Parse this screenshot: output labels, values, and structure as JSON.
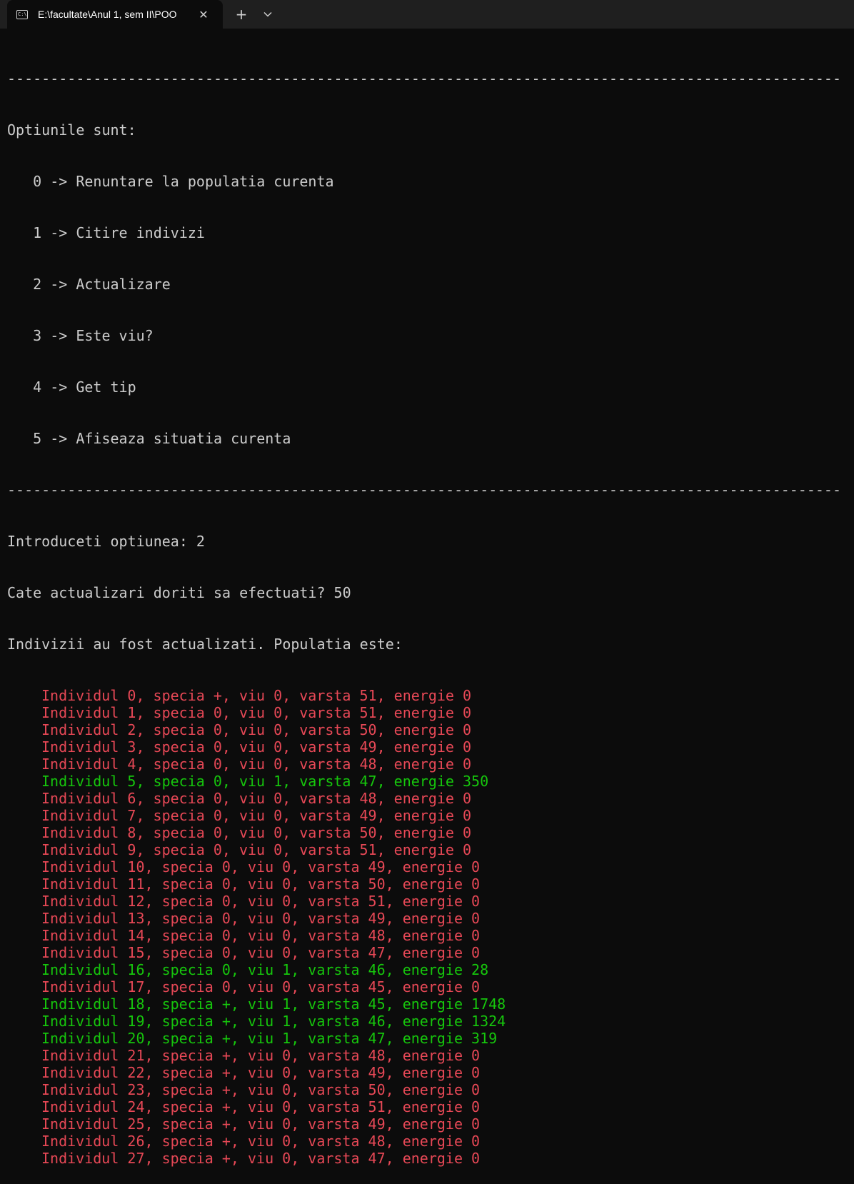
{
  "tab": {
    "title": "E:\\facultate\\Anul 1, sem II\\POO",
    "close_glyph": "✕",
    "icon": "terminal-icon"
  },
  "toolbar": {
    "new_tab_glyph": "+",
    "dropdown_icon": "chevron-down-icon"
  },
  "colors": {
    "background": "#0c0c0c",
    "text": "#cccccc",
    "dead": "#e74856",
    "alive": "#16c60c"
  },
  "console": {
    "separator": "-------------------------------------------------------------------------------------------------",
    "menu_header": "Optiunile sunt:",
    "options": [
      "   0 -> Renuntare la populatia curenta",
      "   1 -> Citire indivizi",
      "   2 -> Actualizare",
      "   3 -> Este viu?",
      "   4 -> Get tip",
      "   5 -> Afiseaza situatia curenta"
    ],
    "prompt": "Introduceti optiunea: 2",
    "question": "Cate actualizari doriti sa efectuati? 50",
    "result": "Indivizii au fost actualizati. Populatia este:",
    "individuals": [
      {
        "text": "Individul 0, specia +, viu 0, varsta 51, energie 0",
        "alive": false
      },
      {
        "text": "Individul 1, specia 0, viu 0, varsta 51, energie 0",
        "alive": false
      },
      {
        "text": "Individul 2, specia 0, viu 0, varsta 50, energie 0",
        "alive": false
      },
      {
        "text": "Individul 3, specia 0, viu 0, varsta 49, energie 0",
        "alive": false
      },
      {
        "text": "Individul 4, specia 0, viu 0, varsta 48, energie 0",
        "alive": false
      },
      {
        "text": "Individul 5, specia 0, viu 1, varsta 47, energie 350",
        "alive": true
      },
      {
        "text": "Individul 6, specia 0, viu 0, varsta 48, energie 0",
        "alive": false
      },
      {
        "text": "Individul 7, specia 0, viu 0, varsta 49, energie 0",
        "alive": false
      },
      {
        "text": "Individul 8, specia 0, viu 0, varsta 50, energie 0",
        "alive": false
      },
      {
        "text": "Individul 9, specia 0, viu 0, varsta 51, energie 0",
        "alive": false
      },
      {
        "text": "Individul 10, specia 0, viu 0, varsta 49, energie 0",
        "alive": false
      },
      {
        "text": "Individul 11, specia 0, viu 0, varsta 50, energie 0",
        "alive": false
      },
      {
        "text": "Individul 12, specia 0, viu 0, varsta 51, energie 0",
        "alive": false
      },
      {
        "text": "Individul 13, specia 0, viu 0, varsta 49, energie 0",
        "alive": false
      },
      {
        "text": "Individul 14, specia 0, viu 0, varsta 48, energie 0",
        "alive": false
      },
      {
        "text": "Individul 15, specia 0, viu 0, varsta 47, energie 0",
        "alive": false
      },
      {
        "text": "Individul 16, specia 0, viu 1, varsta 46, energie 28",
        "alive": true
      },
      {
        "text": "Individul 17, specia 0, viu 0, varsta 45, energie 0",
        "alive": false
      },
      {
        "text": "Individul 18, specia +, viu 1, varsta 45, energie 1748",
        "alive": true
      },
      {
        "text": "Individul 19, specia +, viu 1, varsta 46, energie 1324",
        "alive": true
      },
      {
        "text": "Individul 20, specia +, viu 1, varsta 47, energie 319",
        "alive": true
      },
      {
        "text": "Individul 21, specia +, viu 0, varsta 48, energie 0",
        "alive": false
      },
      {
        "text": "Individul 22, specia +, viu 0, varsta 49, energie 0",
        "alive": false
      },
      {
        "text": "Individul 23, specia +, viu 0, varsta 50, energie 0",
        "alive": false
      },
      {
        "text": "Individul 24, specia +, viu 0, varsta 51, energie 0",
        "alive": false
      },
      {
        "text": "Individul 25, specia +, viu 0, varsta 49, energie 0",
        "alive": false
      },
      {
        "text": "Individul 26, specia +, viu 0, varsta 48, energie 0",
        "alive": false
      },
      {
        "text": "Individul 27, specia +, viu 0, varsta 47, energie 0",
        "alive": false
      }
    ]
  }
}
